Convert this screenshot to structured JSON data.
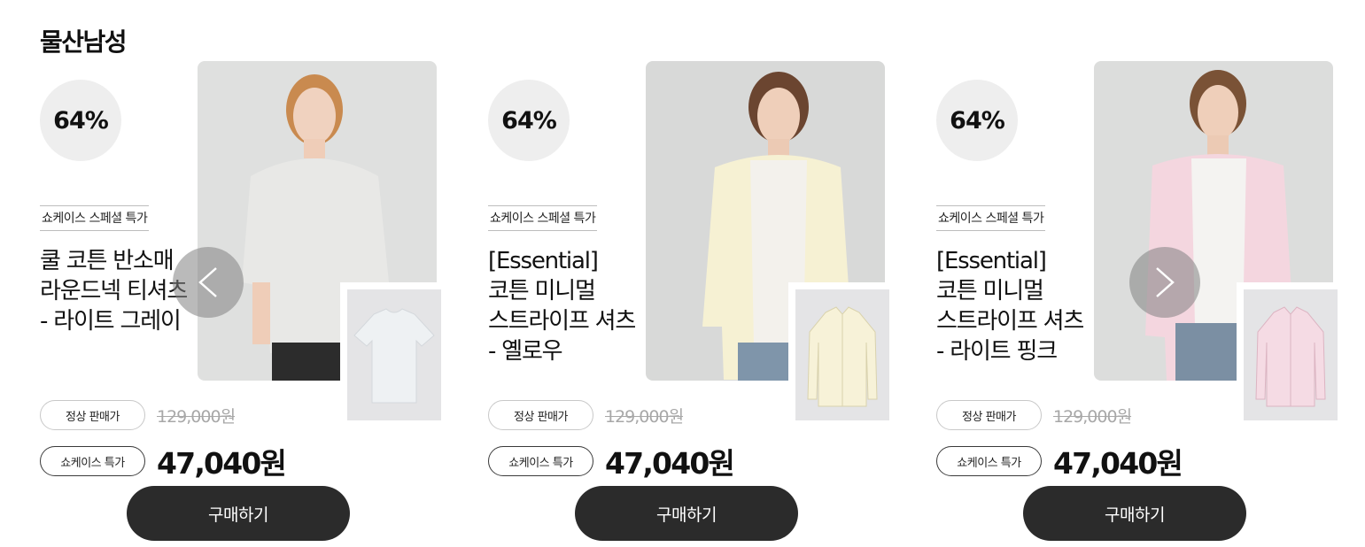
{
  "section": {
    "title": "물산남성"
  },
  "products": [
    {
      "discount": "64%",
      "tag": "쇼케이스 스페셜 특가",
      "name_lines": [
        "쿨 코튼 반소매",
        "라운드넥 티셔츠",
        "- 라이트 그레이"
      ],
      "regular_label": "정상 판매가",
      "regular_price": "129,000원",
      "sale_label": "쇼케이스 특가",
      "sale_price": "47,040원",
      "buy_label": "구매하기",
      "garment_color": "#e8e8e6",
      "thumb_garment_color": "#eef1f3"
    },
    {
      "discount": "64%",
      "tag": "쇼케이스 스페셜 특가",
      "name_lines": [
        "[Essential]",
        "코튼 미니멀",
        "스트라이프 셔츠",
        "- 옐로우"
      ],
      "regular_label": "정상 판매가",
      "regular_price": "129,000원",
      "sale_label": "쇼케이스 특가",
      "sale_price": "47,040원",
      "buy_label": "구매하기",
      "garment_color": "#f6f1d3",
      "thumb_garment_color": "#f7f2d8"
    },
    {
      "discount": "64%",
      "tag": "쇼케이스 스페셜 특가",
      "name_lines": [
        "[Essential]",
        "코튼 미니멀",
        "스트라이프 셔츠",
        "- 라이트 핑크"
      ],
      "regular_label": "정상 판매가",
      "regular_price": "129,000원",
      "sale_label": "쇼케이스 특가",
      "sale_price": "47,040원",
      "buy_label": "구매하기",
      "garment_color": "#f4d6df",
      "thumb_garment_color": "#f5dbe4"
    }
  ],
  "nav": {
    "prev_icon": "chevron-left-icon",
    "next_icon": "chevron-right-icon"
  }
}
